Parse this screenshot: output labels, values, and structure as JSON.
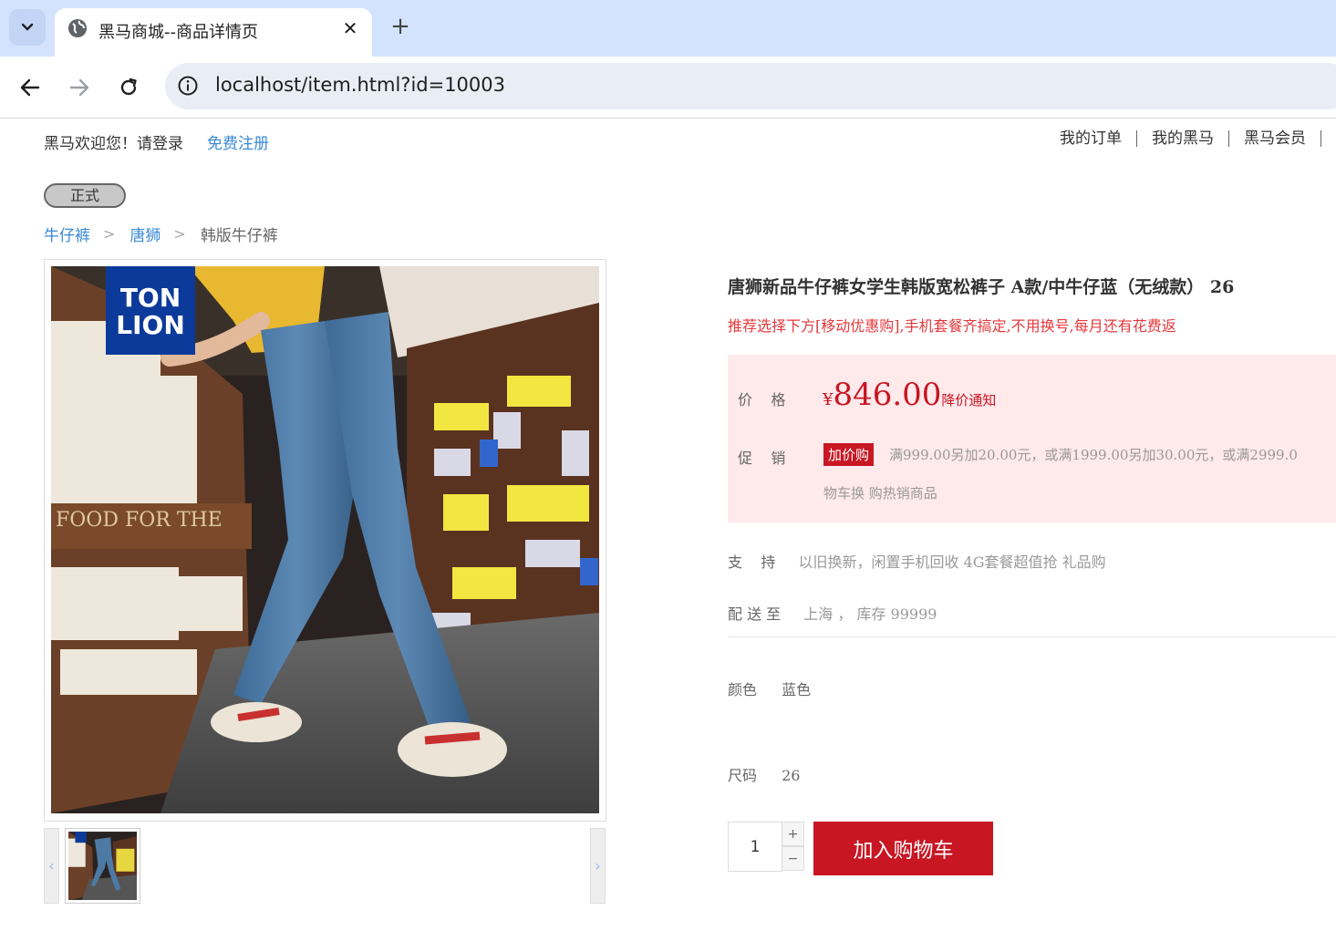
{
  "browser": {
    "tab_title": "黑马商城--商品详情页",
    "url": "localhost/item.html?id=10003",
    "tab_list_icon": "chevron-down-icon",
    "new_tab_label": "+"
  },
  "shortcut": {
    "welcome": "黑马欢迎您！请登录",
    "register": "免费注册",
    "links": [
      "我的订单",
      "我的黑马",
      "黑马会员"
    ]
  },
  "env_badge": "正式",
  "breadcrumb": {
    "items": [
      "牛仔裤",
      "唐狮",
      "韩版牛仔裤"
    ],
    "separator": ">"
  },
  "gallery": {
    "brand_logo_line1": "TON",
    "brand_logo_line2": "LION",
    "prev_arrow": "‹",
    "next_arrow": "›"
  },
  "product": {
    "title": "唐狮新品牛仔裤女学生韩版宽松裤子 A款/中牛仔蓝（无绒款） 26",
    "promo_line": "推荐选择下方[移动优惠购],手机套餐齐搞定,不用换号,每月还有花费返",
    "price_label": "价    格",
    "currency": "¥",
    "price": "846.00",
    "price_notify": "降价通知",
    "promotion_label": "促    销",
    "promotion_tag": "加价购",
    "promotion_text": "满999.00另加20.00元，或满1999.00另加30.00元，或满2999.0",
    "promotion_text2": "物车换 购热销商品",
    "support_label": "支    持",
    "support_value": "以旧换新，闲置手机回收 4G套餐超值抢 礼品购",
    "delivery_label": "配 送 至",
    "delivery_value": "上海 ， 库存 99999",
    "color_label": "颜色",
    "color_value": "蓝色",
    "size_label": "尺码",
    "size_value": "26",
    "quantity": "1",
    "qty_plus": "+",
    "qty_minus": "−",
    "add_to_cart": "加入购物车"
  },
  "colors": {
    "accent_red": "#c81623",
    "link_blue": "#3a8ad6",
    "price_bg": "#fee9eb",
    "chrome_blue": "#d3e3fd"
  }
}
